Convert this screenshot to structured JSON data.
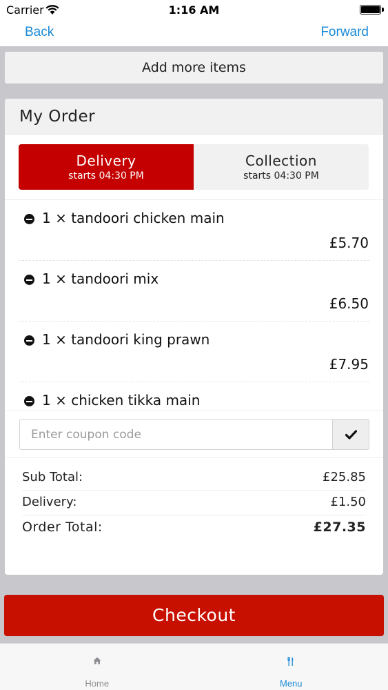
{
  "status_bar": {
    "carrier": "Carrier",
    "time": "1:16 AM"
  },
  "nav": {
    "back_label": "Back",
    "forward_label": "Forward"
  },
  "add_more_label": "Add more items",
  "order": {
    "title": "My Order",
    "modes": [
      {
        "label": "Delivery",
        "subtitle": "starts 04:30 PM",
        "active": true
      },
      {
        "label": "Collection",
        "subtitle": "starts 04:30 PM",
        "active": false
      }
    ],
    "items": [
      {
        "name": "1 × tandoori chicken main",
        "price": "£5.70"
      },
      {
        "name": "1 × tandoori mix",
        "price": "£6.50"
      },
      {
        "name": "1 × tandoori king prawn",
        "price": "£7.95"
      },
      {
        "name": "1 × chicken tikka main",
        "price": ""
      }
    ],
    "coupon": {
      "placeholder": "Enter coupon code",
      "value": ""
    },
    "totals": {
      "sub_total_label": "Sub Total:",
      "sub_total_value": "£25.85",
      "delivery_label": "Delivery:",
      "delivery_value": "£1.50",
      "order_total_label": "Order Total:",
      "order_total_value": "£27.35"
    }
  },
  "checkout_label": "Checkout",
  "tabbar": {
    "tabs": [
      {
        "label": "Home",
        "icon": "home-icon",
        "active": false
      },
      {
        "label": "Menu",
        "icon": "cutlery-icon",
        "active": true
      }
    ]
  },
  "colors": {
    "accent_blue": "#1a8ad6",
    "active_red": "#c40000",
    "checkout_red": "#c81000"
  }
}
